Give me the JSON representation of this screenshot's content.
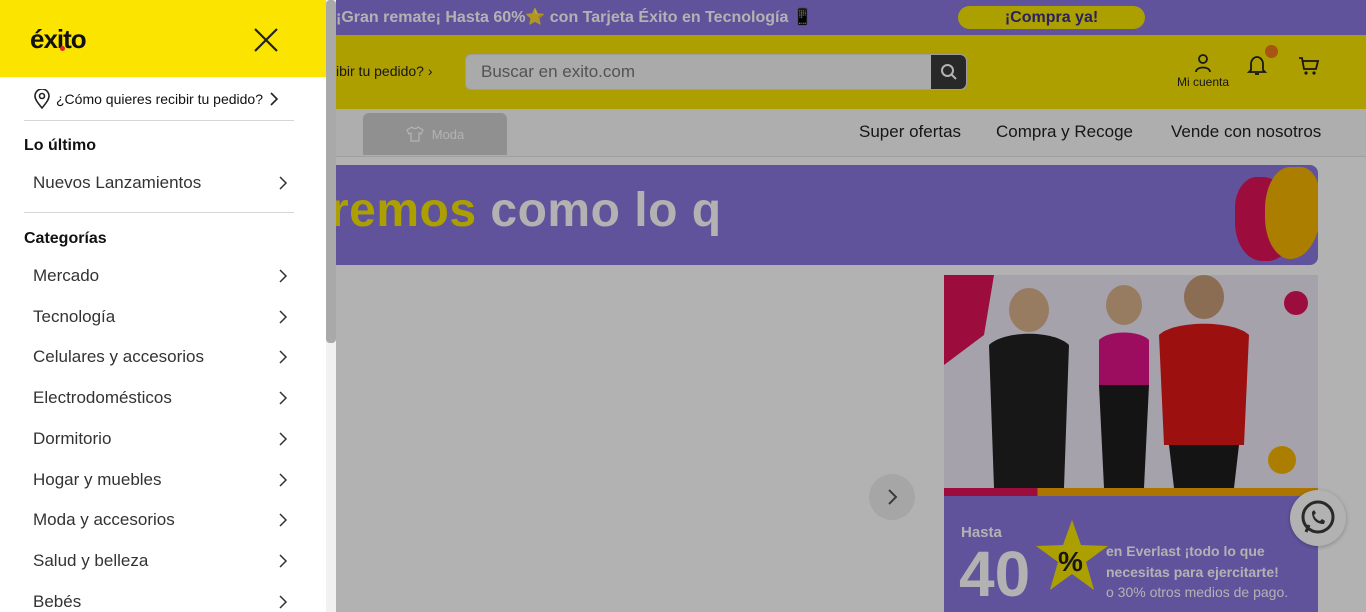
{
  "promo": {
    "text": "¡Gran remate¡ Hasta 60%⭐ con Tarjeta Éxito en Tecnología 📱",
    "cta": "¡Compra ya!"
  },
  "header": {
    "deliver_label": "ibir tu pedido?",
    "search_placeholder": "Buscar en exito.com",
    "account_label": "Mi cuenta"
  },
  "nav": {
    "moda_label": "Moda",
    "links": [
      "Super ofertas",
      "Compra y Recoge",
      "Vende con nosotros"
    ]
  },
  "banner": {
    "text_yellow": "remos",
    "text_white": " como lo q"
  },
  "promo_card": {
    "hasta": "Hasta",
    "number": "40",
    "percent": "%",
    "copy": "en Everlast ¡todo lo que necesitas para ejercitarte!",
    "copy_small": "o 30% otros medios de pago."
  },
  "drawer": {
    "logo": "éxito",
    "deliver_question": "¿Cómo quieres recibir tu pedido?",
    "section_latest": "Lo último",
    "latest_items": [
      "Nuevos Lanzamientos"
    ],
    "section_categories": "Categorías",
    "categories": [
      "Mercado",
      "Tecnología",
      "Celulares y accesorios",
      "Electrodomésticos",
      "Dormitorio",
      "Hogar y muebles",
      "Moda y accesorios",
      "Salud y belleza",
      "Bebés"
    ]
  },
  "colors": {
    "brand_yellow": "#fae400",
    "brand_purple": "#8a78e0",
    "overlay": "rgba(0,0,0,0.30)"
  }
}
